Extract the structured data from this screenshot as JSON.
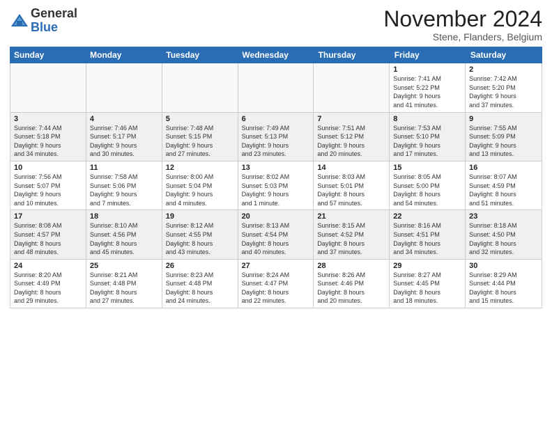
{
  "logo": {
    "general": "General",
    "blue": "Blue"
  },
  "title": "November 2024",
  "location": "Stene, Flanders, Belgium",
  "days_header": [
    "Sunday",
    "Monday",
    "Tuesday",
    "Wednesday",
    "Thursday",
    "Friday",
    "Saturday"
  ],
  "weeks": [
    [
      {
        "day": "",
        "info": "",
        "empty": true
      },
      {
        "day": "",
        "info": "",
        "empty": true
      },
      {
        "day": "",
        "info": "",
        "empty": true
      },
      {
        "day": "",
        "info": "",
        "empty": true
      },
      {
        "day": "",
        "info": "",
        "empty": true
      },
      {
        "day": "1",
        "info": "Sunrise: 7:41 AM\nSunset: 5:22 PM\nDaylight: 9 hours\nand 41 minutes."
      },
      {
        "day": "2",
        "info": "Sunrise: 7:42 AM\nSunset: 5:20 PM\nDaylight: 9 hours\nand 37 minutes."
      }
    ],
    [
      {
        "day": "3",
        "info": "Sunrise: 7:44 AM\nSunset: 5:18 PM\nDaylight: 9 hours\nand 34 minutes."
      },
      {
        "day": "4",
        "info": "Sunrise: 7:46 AM\nSunset: 5:17 PM\nDaylight: 9 hours\nand 30 minutes."
      },
      {
        "day": "5",
        "info": "Sunrise: 7:48 AM\nSunset: 5:15 PM\nDaylight: 9 hours\nand 27 minutes."
      },
      {
        "day": "6",
        "info": "Sunrise: 7:49 AM\nSunset: 5:13 PM\nDaylight: 9 hours\nand 23 minutes."
      },
      {
        "day": "7",
        "info": "Sunrise: 7:51 AM\nSunset: 5:12 PM\nDaylight: 9 hours\nand 20 minutes."
      },
      {
        "day": "8",
        "info": "Sunrise: 7:53 AM\nSunset: 5:10 PM\nDaylight: 9 hours\nand 17 minutes."
      },
      {
        "day": "9",
        "info": "Sunrise: 7:55 AM\nSunset: 5:09 PM\nDaylight: 9 hours\nand 13 minutes."
      }
    ],
    [
      {
        "day": "10",
        "info": "Sunrise: 7:56 AM\nSunset: 5:07 PM\nDaylight: 9 hours\nand 10 minutes."
      },
      {
        "day": "11",
        "info": "Sunrise: 7:58 AM\nSunset: 5:06 PM\nDaylight: 9 hours\nand 7 minutes."
      },
      {
        "day": "12",
        "info": "Sunrise: 8:00 AM\nSunset: 5:04 PM\nDaylight: 9 hours\nand 4 minutes."
      },
      {
        "day": "13",
        "info": "Sunrise: 8:02 AM\nSunset: 5:03 PM\nDaylight: 9 hours\nand 1 minute."
      },
      {
        "day": "14",
        "info": "Sunrise: 8:03 AM\nSunset: 5:01 PM\nDaylight: 8 hours\nand 57 minutes."
      },
      {
        "day": "15",
        "info": "Sunrise: 8:05 AM\nSunset: 5:00 PM\nDaylight: 8 hours\nand 54 minutes."
      },
      {
        "day": "16",
        "info": "Sunrise: 8:07 AM\nSunset: 4:59 PM\nDaylight: 8 hours\nand 51 minutes."
      }
    ],
    [
      {
        "day": "17",
        "info": "Sunrise: 8:08 AM\nSunset: 4:57 PM\nDaylight: 8 hours\nand 48 minutes."
      },
      {
        "day": "18",
        "info": "Sunrise: 8:10 AM\nSunset: 4:56 PM\nDaylight: 8 hours\nand 45 minutes."
      },
      {
        "day": "19",
        "info": "Sunrise: 8:12 AM\nSunset: 4:55 PM\nDaylight: 8 hours\nand 43 minutes."
      },
      {
        "day": "20",
        "info": "Sunrise: 8:13 AM\nSunset: 4:54 PM\nDaylight: 8 hours\nand 40 minutes."
      },
      {
        "day": "21",
        "info": "Sunrise: 8:15 AM\nSunset: 4:52 PM\nDaylight: 8 hours\nand 37 minutes."
      },
      {
        "day": "22",
        "info": "Sunrise: 8:16 AM\nSunset: 4:51 PM\nDaylight: 8 hours\nand 34 minutes."
      },
      {
        "day": "23",
        "info": "Sunrise: 8:18 AM\nSunset: 4:50 PM\nDaylight: 8 hours\nand 32 minutes."
      }
    ],
    [
      {
        "day": "24",
        "info": "Sunrise: 8:20 AM\nSunset: 4:49 PM\nDaylight: 8 hours\nand 29 minutes."
      },
      {
        "day": "25",
        "info": "Sunrise: 8:21 AM\nSunset: 4:48 PM\nDaylight: 8 hours\nand 27 minutes."
      },
      {
        "day": "26",
        "info": "Sunrise: 8:23 AM\nSunset: 4:48 PM\nDaylight: 8 hours\nand 24 minutes."
      },
      {
        "day": "27",
        "info": "Sunrise: 8:24 AM\nSunset: 4:47 PM\nDaylight: 8 hours\nand 22 minutes."
      },
      {
        "day": "28",
        "info": "Sunrise: 8:26 AM\nSunset: 4:46 PM\nDaylight: 8 hours\nand 20 minutes."
      },
      {
        "day": "29",
        "info": "Sunrise: 8:27 AM\nSunset: 4:45 PM\nDaylight: 8 hours\nand 18 minutes."
      },
      {
        "day": "30",
        "info": "Sunrise: 8:29 AM\nSunset: 4:44 PM\nDaylight: 8 hours\nand 15 minutes."
      }
    ]
  ]
}
